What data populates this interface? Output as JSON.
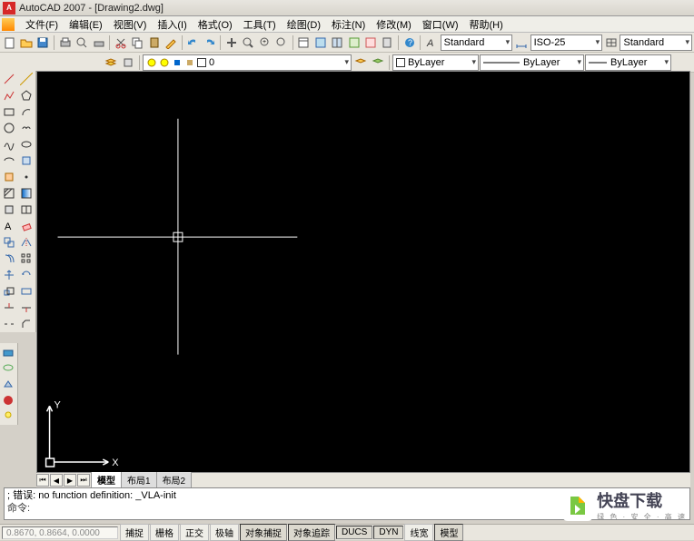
{
  "title": "AutoCAD 2007 - [Drawing2.dwg]",
  "menu": {
    "items": [
      {
        "label": "文件(F)"
      },
      {
        "label": "编辑(E)"
      },
      {
        "label": "视图(V)"
      },
      {
        "label": "插入(I)"
      },
      {
        "label": "格式(O)"
      },
      {
        "label": "工具(T)"
      },
      {
        "label": "绘图(D)"
      },
      {
        "label": "标注(N)"
      },
      {
        "label": "修改(M)"
      },
      {
        "label": "窗口(W)"
      },
      {
        "label": "帮助(H)"
      }
    ]
  },
  "toolbar1": {
    "styles_dd1": "Standard",
    "styles_dd2": "ISO-25",
    "styles_dd3": "Standard"
  },
  "toolbar2": {
    "layer_dd": "0",
    "color_dd": "ByLayer",
    "linetype_dd": "ByLayer",
    "lineweight_dd": "ByLayer"
  },
  "doc_tabs": {
    "items": [
      {
        "label": "模型",
        "active": true
      },
      {
        "label": "布局1",
        "active": false
      },
      {
        "label": "布局2",
        "active": false
      }
    ]
  },
  "command": {
    "line1": "; 错误: no function definition: _VLA-init",
    "prompt": "命令:"
  },
  "status": {
    "coords": "0.8670, 0.8664, 0.0000",
    "buttons": [
      {
        "label": "捕捉"
      },
      {
        "label": "栅格"
      },
      {
        "label": "正交"
      },
      {
        "label": "极轴"
      },
      {
        "label": "对象捕捉"
      },
      {
        "label": "对象追踪"
      },
      {
        "label": "DUCS"
      },
      {
        "label": "DYN"
      },
      {
        "label": "线宽"
      },
      {
        "label": "模型"
      }
    ]
  },
  "ucs": {
    "x": "X",
    "y": "Y"
  },
  "watermark": {
    "main": "快盘下载",
    "sub": "绿 色 · 安 全 · 高 速"
  }
}
